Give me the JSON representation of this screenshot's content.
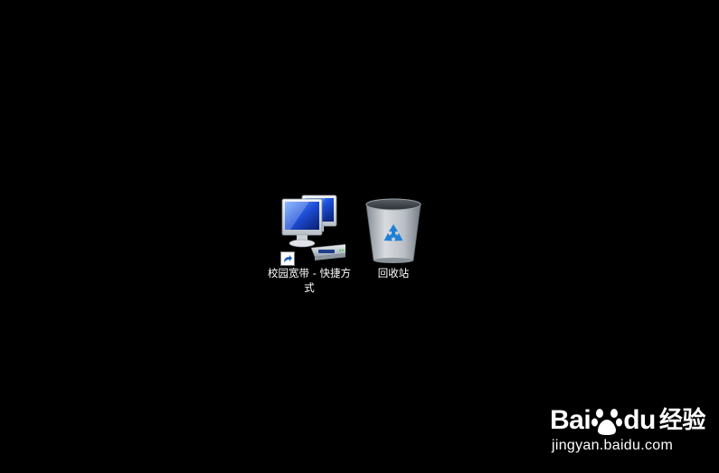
{
  "desktop": {
    "background_color": "#000000",
    "icons": [
      {
        "label": "校园宽带 - 快捷方式",
        "icon": "network-computers-icon",
        "shortcut_overlay": "shortcut-arrow-icon"
      },
      {
        "label": "回收站",
        "icon": "recycle-bin-icon"
      }
    ]
  },
  "watermark": {
    "logo_text_left": "Bai",
    "logo_text_right": "du",
    "logo_suffix": "经验",
    "url": "jingyan.baidu.com"
  }
}
